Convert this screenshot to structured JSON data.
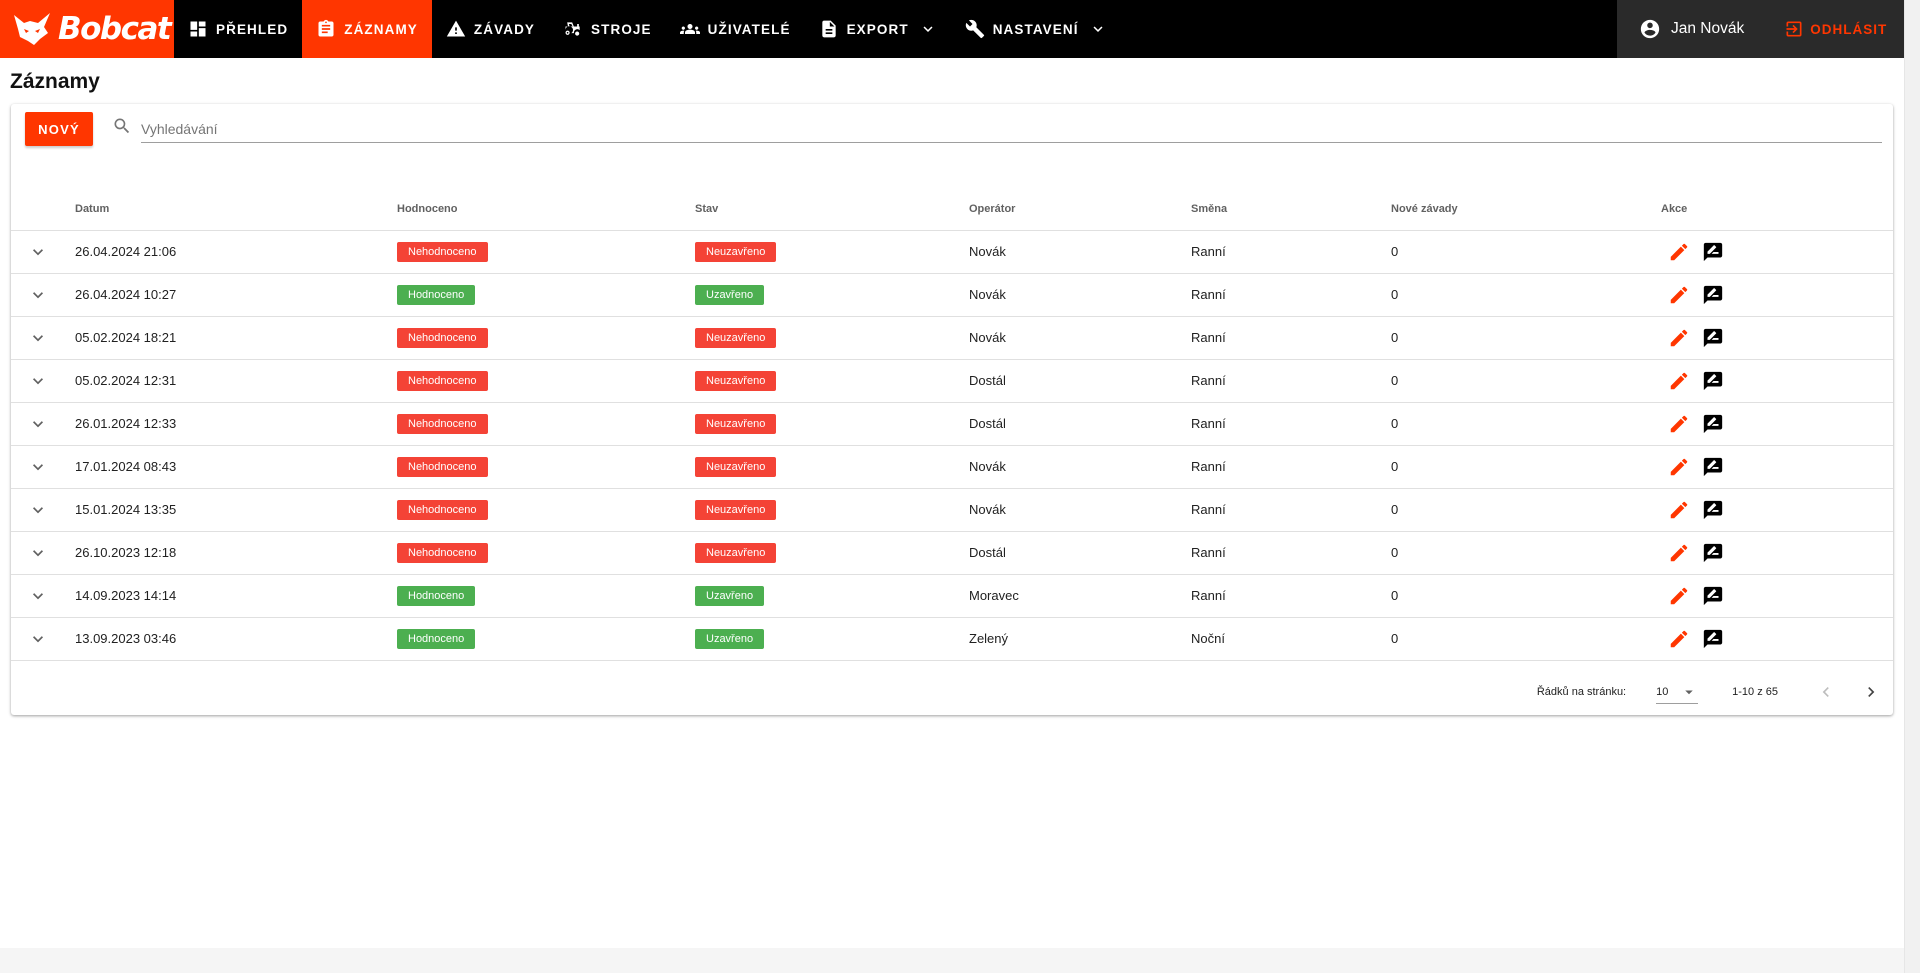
{
  "brand": {
    "name": "Bobcat",
    "color": "#ff3600"
  },
  "nav": [
    {
      "label": "Přehled",
      "icon": "dashboard-icon",
      "active": false
    },
    {
      "label": "Záznamy",
      "icon": "clipboard-icon",
      "active": true
    },
    {
      "label": "Závady",
      "icon": "warning-icon",
      "active": false
    },
    {
      "label": "Stroje",
      "icon": "tractor-icon",
      "active": false
    },
    {
      "label": "Uživatelé",
      "icon": "users-icon",
      "active": false
    },
    {
      "label": "Export",
      "icon": "file-icon",
      "active": false,
      "dropdown": true
    },
    {
      "label": "Nastavení",
      "icon": "wrench-icon",
      "active": false,
      "dropdown": true
    }
  ],
  "user": {
    "name": "Jan Novák",
    "logout_label": "Odhlásit"
  },
  "page": {
    "title": "Záznamy"
  },
  "toolbar": {
    "new_label": "Nový",
    "search_placeholder": "Vyhledávání"
  },
  "table": {
    "headers": [
      "Datum",
      "Hodnoceno",
      "Stav",
      "Operátor",
      "Směna",
      "Nové závady",
      "Akce"
    ],
    "rows": [
      {
        "date": "26.04.2024 21:06",
        "eval": "Nehodnoceno",
        "state": "Neuzavřeno",
        "operator": "Novák",
        "shift": "Ranní",
        "new_faults": "0"
      },
      {
        "date": "26.04.2024 10:27",
        "eval": "Hodnoceno",
        "state": "Uzavřeno",
        "operator": "Novák",
        "shift": "Ranní",
        "new_faults": "0"
      },
      {
        "date": "05.02.2024 18:21",
        "eval": "Nehodnoceno",
        "state": "Neuzavřeno",
        "operator": "Novák",
        "shift": "Ranní",
        "new_faults": "0"
      },
      {
        "date": "05.02.2024 12:31",
        "eval": "Nehodnoceno",
        "state": "Neuzavřeno",
        "operator": "Dostál",
        "shift": "Ranní",
        "new_faults": "0"
      },
      {
        "date": "26.01.2024 12:33",
        "eval": "Nehodnoceno",
        "state": "Neuzavřeno",
        "operator": "Dostál",
        "shift": "Ranní",
        "new_faults": "0"
      },
      {
        "date": "17.01.2024 08:43",
        "eval": "Nehodnoceno",
        "state": "Neuzavřeno",
        "operator": "Novák",
        "shift": "Ranní",
        "new_faults": "0"
      },
      {
        "date": "15.01.2024 13:35",
        "eval": "Nehodnoceno",
        "state": "Neuzavřeno",
        "operator": "Novák",
        "shift": "Ranní",
        "new_faults": "0"
      },
      {
        "date": "26.10.2023 12:18",
        "eval": "Nehodnoceno",
        "state": "Neuzavřeno",
        "operator": "Dostál",
        "shift": "Ranní",
        "new_faults": "0"
      },
      {
        "date": "14.09.2023 14:14",
        "eval": "Hodnoceno",
        "state": "Uzavřeno",
        "operator": "Moravec",
        "shift": "Ranní",
        "new_faults": "0"
      },
      {
        "date": "13.09.2023 03:46",
        "eval": "Hodnoceno",
        "state": "Uzavřeno",
        "operator": "Zelený",
        "shift": "Noční",
        "new_faults": "0"
      }
    ]
  },
  "pagination": {
    "rows_per_page_label": "Řádků na stránku:",
    "rows_per_page": "10",
    "range": "1-10 z 65"
  },
  "colors": {
    "accent": "#ff3600",
    "chip_red": "#f44336",
    "chip_green": "#4caf50"
  }
}
